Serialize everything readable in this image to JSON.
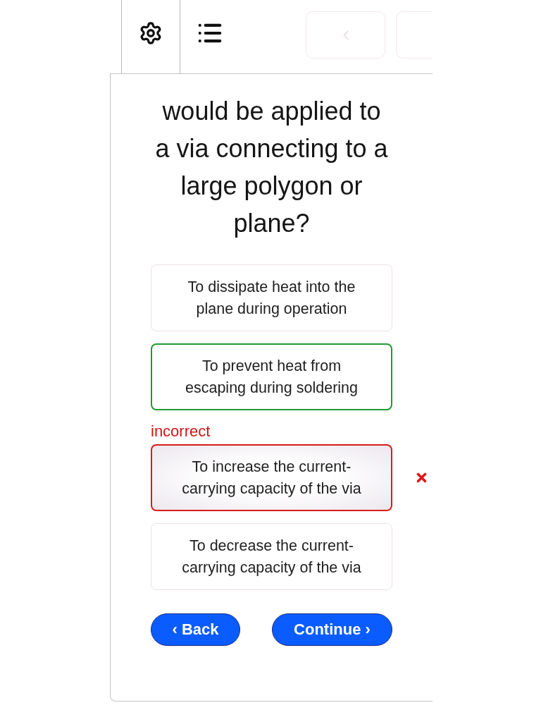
{
  "toolbar": [
    {
      "kind": "settings"
    },
    {
      "kind": "menu"
    },
    {
      "kind": "previous",
      "disabled": true
    },
    {
      "kind": "next",
      "disabled": true
    }
  ],
  "question": "would be applied to a via connecting to a large polygon or plane?",
  "options": [
    {
      "text": "To dissipate heat into the plane during operation",
      "selected": false,
      "correct": false,
      "incorrect": false
    },
    {
      "text": "To prevent heat from escaping during soldering",
      "selected": false,
      "correct": true,
      "incorrect": false
    },
    {
      "text": "To increase the current-carrying capacity of the via",
      "selected": true,
      "correct": false,
      "incorrect": true,
      "feedback": "incorrect"
    },
    {
      "text": "To decrease the current-carrying capacity of the via",
      "selected": false,
      "correct": false,
      "incorrect": false
    }
  ],
  "buttons": [
    {
      "kind": "back",
      "label": "‹ Back"
    },
    {
      "kind": "continue",
      "label": "Continue ›"
    }
  ]
}
